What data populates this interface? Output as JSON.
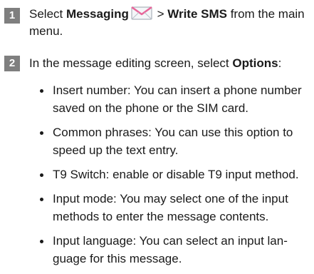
{
  "steps": [
    {
      "number": "1",
      "text_before": "Select ",
      "bold_1": "Messaging",
      "icon": "messaging-envelope-icon",
      "text_middle": " > ",
      "bold_2": "Write SMS",
      "text_after": " from the main menu."
    },
    {
      "number": "2",
      "text_before": "In the message editing screen, select ",
      "bold_1": "Options",
      "text_after": ":"
    }
  ],
  "bullets": [
    "Insert number: You can insert a phone number saved on the phone or the SIM card.",
    "Common phrases: You can use this option to speed up the text entry.",
    "T9 Switch: enable or disable T9 input method.",
    "Input mode: You may select one of the input methods to enter the message contents.",
    "Input language: You can select an input lan- guage for this message."
  ],
  "colors": {
    "badge_background": "#7f7f7f",
    "badge_text": "#ffffff",
    "envelope_pink": "#e8669a",
    "envelope_body": "#f4f6f8"
  }
}
